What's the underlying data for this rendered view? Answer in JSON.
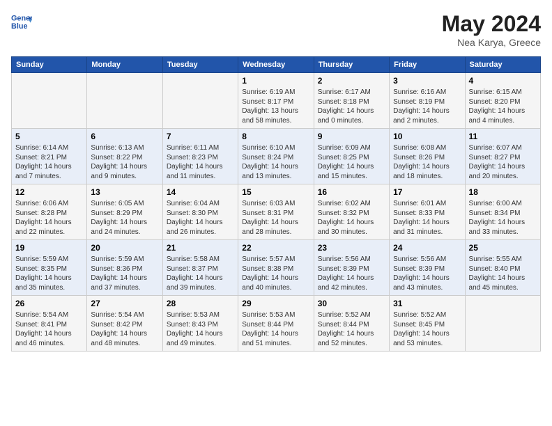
{
  "header": {
    "logo_line1": "General",
    "logo_line2": "Blue",
    "month": "May 2024",
    "location": "Nea Karya, Greece"
  },
  "weekdays": [
    "Sunday",
    "Monday",
    "Tuesday",
    "Wednesday",
    "Thursday",
    "Friday",
    "Saturday"
  ],
  "weeks": [
    [
      {
        "day": "",
        "info": ""
      },
      {
        "day": "",
        "info": ""
      },
      {
        "day": "",
        "info": ""
      },
      {
        "day": "1",
        "info": "Sunrise: 6:19 AM\nSunset: 8:17 PM\nDaylight: 13 hours and 58 minutes."
      },
      {
        "day": "2",
        "info": "Sunrise: 6:17 AM\nSunset: 8:18 PM\nDaylight: 14 hours and 0 minutes."
      },
      {
        "day": "3",
        "info": "Sunrise: 6:16 AM\nSunset: 8:19 PM\nDaylight: 14 hours and 2 minutes."
      },
      {
        "day": "4",
        "info": "Sunrise: 6:15 AM\nSunset: 8:20 PM\nDaylight: 14 hours and 4 minutes."
      }
    ],
    [
      {
        "day": "5",
        "info": "Sunrise: 6:14 AM\nSunset: 8:21 PM\nDaylight: 14 hours and 7 minutes."
      },
      {
        "day": "6",
        "info": "Sunrise: 6:13 AM\nSunset: 8:22 PM\nDaylight: 14 hours and 9 minutes."
      },
      {
        "day": "7",
        "info": "Sunrise: 6:11 AM\nSunset: 8:23 PM\nDaylight: 14 hours and 11 minutes."
      },
      {
        "day": "8",
        "info": "Sunrise: 6:10 AM\nSunset: 8:24 PM\nDaylight: 14 hours and 13 minutes."
      },
      {
        "day": "9",
        "info": "Sunrise: 6:09 AM\nSunset: 8:25 PM\nDaylight: 14 hours and 15 minutes."
      },
      {
        "day": "10",
        "info": "Sunrise: 6:08 AM\nSunset: 8:26 PM\nDaylight: 14 hours and 18 minutes."
      },
      {
        "day": "11",
        "info": "Sunrise: 6:07 AM\nSunset: 8:27 PM\nDaylight: 14 hours and 20 minutes."
      }
    ],
    [
      {
        "day": "12",
        "info": "Sunrise: 6:06 AM\nSunset: 8:28 PM\nDaylight: 14 hours and 22 minutes."
      },
      {
        "day": "13",
        "info": "Sunrise: 6:05 AM\nSunset: 8:29 PM\nDaylight: 14 hours and 24 minutes."
      },
      {
        "day": "14",
        "info": "Sunrise: 6:04 AM\nSunset: 8:30 PM\nDaylight: 14 hours and 26 minutes."
      },
      {
        "day": "15",
        "info": "Sunrise: 6:03 AM\nSunset: 8:31 PM\nDaylight: 14 hours and 28 minutes."
      },
      {
        "day": "16",
        "info": "Sunrise: 6:02 AM\nSunset: 8:32 PM\nDaylight: 14 hours and 30 minutes."
      },
      {
        "day": "17",
        "info": "Sunrise: 6:01 AM\nSunset: 8:33 PM\nDaylight: 14 hours and 31 minutes."
      },
      {
        "day": "18",
        "info": "Sunrise: 6:00 AM\nSunset: 8:34 PM\nDaylight: 14 hours and 33 minutes."
      }
    ],
    [
      {
        "day": "19",
        "info": "Sunrise: 5:59 AM\nSunset: 8:35 PM\nDaylight: 14 hours and 35 minutes."
      },
      {
        "day": "20",
        "info": "Sunrise: 5:59 AM\nSunset: 8:36 PM\nDaylight: 14 hours and 37 minutes."
      },
      {
        "day": "21",
        "info": "Sunrise: 5:58 AM\nSunset: 8:37 PM\nDaylight: 14 hours and 39 minutes."
      },
      {
        "day": "22",
        "info": "Sunrise: 5:57 AM\nSunset: 8:38 PM\nDaylight: 14 hours and 40 minutes."
      },
      {
        "day": "23",
        "info": "Sunrise: 5:56 AM\nSunset: 8:39 PM\nDaylight: 14 hours and 42 minutes."
      },
      {
        "day": "24",
        "info": "Sunrise: 5:56 AM\nSunset: 8:39 PM\nDaylight: 14 hours and 43 minutes."
      },
      {
        "day": "25",
        "info": "Sunrise: 5:55 AM\nSunset: 8:40 PM\nDaylight: 14 hours and 45 minutes."
      }
    ],
    [
      {
        "day": "26",
        "info": "Sunrise: 5:54 AM\nSunset: 8:41 PM\nDaylight: 14 hours and 46 minutes."
      },
      {
        "day": "27",
        "info": "Sunrise: 5:54 AM\nSunset: 8:42 PM\nDaylight: 14 hours and 48 minutes."
      },
      {
        "day": "28",
        "info": "Sunrise: 5:53 AM\nSunset: 8:43 PM\nDaylight: 14 hours and 49 minutes."
      },
      {
        "day": "29",
        "info": "Sunrise: 5:53 AM\nSunset: 8:44 PM\nDaylight: 14 hours and 51 minutes."
      },
      {
        "day": "30",
        "info": "Sunrise: 5:52 AM\nSunset: 8:44 PM\nDaylight: 14 hours and 52 minutes."
      },
      {
        "day": "31",
        "info": "Sunrise: 5:52 AM\nSunset: 8:45 PM\nDaylight: 14 hours and 53 minutes."
      },
      {
        "day": "",
        "info": ""
      }
    ]
  ]
}
